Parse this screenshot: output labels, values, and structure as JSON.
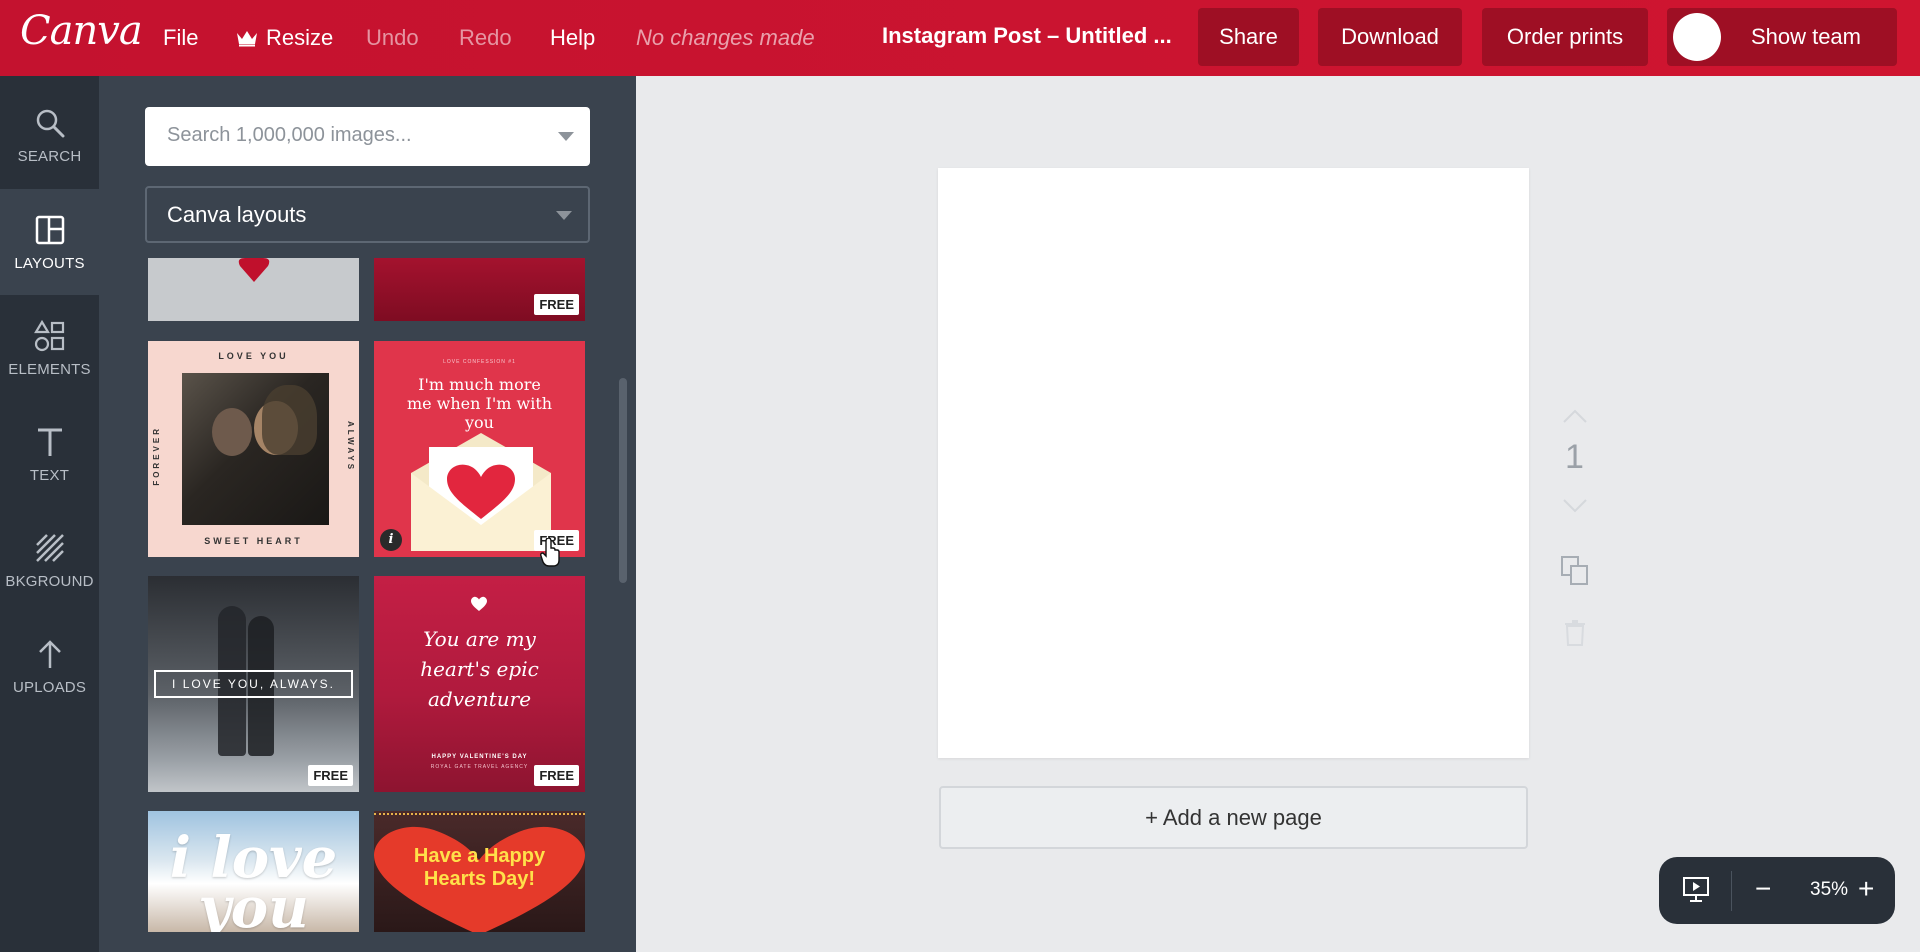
{
  "app": {
    "logo": "Canva"
  },
  "topbar": {
    "file": "File",
    "resize": "Resize",
    "undo": "Undo",
    "redo": "Redo",
    "help": "Help",
    "status": "No changes made",
    "doc_title": "Instagram Post – Untitled ...",
    "share": "Share",
    "download": "Download",
    "order_prints": "Order prints",
    "show_team": "Show team"
  },
  "rail": {
    "search": "SEARCH",
    "layouts": "LAYOUTS",
    "elements": "ELEMENTS",
    "text": "TEXT",
    "background": "BKGROUND",
    "uploads": "UPLOADS",
    "active": "layouts"
  },
  "panel": {
    "search_placeholder": "Search 1,000,000 images...",
    "category": "Canva layouts",
    "free_label": "FREE",
    "layouts": [
      {
        "id": "love-you-forever",
        "top_text": "LOVE YOU",
        "left_text": "FOREVER",
        "right_text": "ALWAYS",
        "bottom_text": "SWEET HEART",
        "free": false
      },
      {
        "id": "much-more-me",
        "kicker": "LOVE CONFESSION #1",
        "headline": "I'm much more me when I'm with you",
        "free": true
      },
      {
        "id": "i-love-you-always",
        "headline": "I LOVE YOU, ALWAYS.",
        "free": true
      },
      {
        "id": "hearts-epic-adventure",
        "headline": "You are my heart's epic adventure",
        "footer1": "HAPPY VALENTINE'S DAY",
        "footer2": "ROYAL GATE TRAVEL AGENCY",
        "free": true
      },
      {
        "id": "i-love-you",
        "headline": "i love you",
        "free": false
      },
      {
        "id": "happy-hearts-day",
        "headline": "Have a Happy Hearts Day!",
        "free": false
      }
    ]
  },
  "canvas": {
    "page_number": "1",
    "add_page": "+ Add a new page"
  },
  "zoom": {
    "value": "35%",
    "minus": "−",
    "plus": "+"
  },
  "colors": {
    "brand": "#c4122f",
    "dark_rail": "#293039",
    "panel": "#3a434e"
  }
}
